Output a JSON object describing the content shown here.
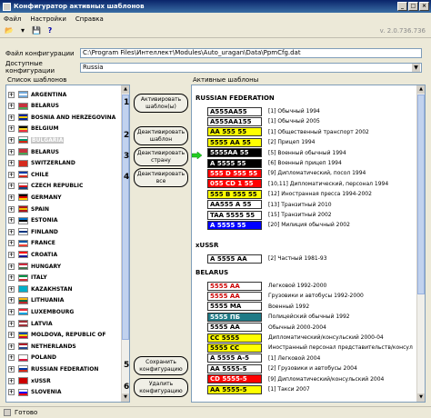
{
  "window": {
    "title": "Конфигуратор активных шаблонов",
    "controls": [
      "_",
      "□",
      "×"
    ]
  },
  "menu": [
    "Файл",
    "Настройки",
    "Справка"
  ],
  "version": "v. 2.0.736.736",
  "config_file": {
    "label": "Файл конфигурации",
    "value": "C:\\Program Files\\Интеллект\\Modules\\Auto_uragan\\Data\\PpmCfg.dat"
  },
  "available_configs": {
    "label": "Доступные конфигурации",
    "value": "Russia"
  },
  "template_list_label": "Список шаблонов",
  "active_templates_label": "Активные шаблоны",
  "countries": [
    {
      "name": "ARGENTINA",
      "colors": [
        "#75aadb",
        "#ffffff",
        "#75aadb"
      ]
    },
    {
      "name": "BELARUS",
      "colors": [
        "#c8313e",
        "#c8313e",
        "#4aa657"
      ]
    },
    {
      "name": "BOSNIA AND HERZEGOVINA",
      "colors": [
        "#002395",
        "#fecb00",
        "#002395"
      ]
    },
    {
      "name": "BELGIUM",
      "colors": [
        "#000000",
        "#fdda24",
        "#ef3340"
      ]
    },
    {
      "name": "BULGARIA",
      "colors": [
        "#ffffff",
        "#00966e",
        "#d62612"
      ]
    },
    {
      "name": "BELARUS",
      "colors": [
        "#c8313e",
        "#c8313e",
        "#4aa657"
      ]
    },
    {
      "name": "SWITZERLAND",
      "colors": [
        "#d52b1e",
        "#d52b1e",
        "#d52b1e"
      ]
    },
    {
      "name": "CHILE",
      "colors": [
        "#0039a6",
        "#ffffff",
        "#d52b1e"
      ]
    },
    {
      "name": "CZECH REPUBLIC",
      "colors": [
        "#ffffff",
        "#d7141a",
        "#11457e"
      ]
    },
    {
      "name": "GERMANY",
      "colors": [
        "#000000",
        "#dd0000",
        "#ffce00"
      ]
    },
    {
      "name": "SPAIN",
      "colors": [
        "#aa151b",
        "#f1bf00",
        "#aa151b"
      ]
    },
    {
      "name": "ESTONIA",
      "colors": [
        "#0072ce",
        "#000000",
        "#ffffff"
      ]
    },
    {
      "name": "FINLAND",
      "colors": [
        "#ffffff",
        "#003580",
        "#ffffff"
      ]
    },
    {
      "name": "FRANCE",
      "colors": [
        "#0055a4",
        "#ffffff",
        "#ef4135"
      ]
    },
    {
      "name": "CROATIA",
      "colors": [
        "#ff0000",
        "#ffffff",
        "#171796"
      ]
    },
    {
      "name": "HUNGARY",
      "colors": [
        "#cd2a3e",
        "#ffffff",
        "#436f4d"
      ]
    },
    {
      "name": "ITALY",
      "colors": [
        "#009246",
        "#ffffff",
        "#ce2b37"
      ]
    },
    {
      "name": "KAZAKHSTAN",
      "colors": [
        "#00afca",
        "#00afca",
        "#00afca"
      ]
    },
    {
      "name": "LITHUANIA",
      "colors": [
        "#fdb913",
        "#006a44",
        "#c1272d"
      ]
    },
    {
      "name": "LUXEMBOURG",
      "colors": [
        "#ed2939",
        "#ffffff",
        "#00a1de"
      ]
    },
    {
      "name": "LATVIA",
      "colors": [
        "#9e3039",
        "#ffffff",
        "#9e3039"
      ]
    },
    {
      "name": "MOLDOVA, REPUBLIC OF",
      "colors": [
        "#0046ae",
        "#ffd200",
        "#cc092f"
      ]
    },
    {
      "name": "NETHERLANDS",
      "colors": [
        "#ae1c28",
        "#ffffff",
        "#21468b"
      ]
    },
    {
      "name": "POLAND",
      "colors": [
        "#ffffff",
        "#ffffff",
        "#dc143c"
      ]
    },
    {
      "name": "RUSSIAN FEDERATION",
      "colors": [
        "#ffffff",
        "#0039a6",
        "#d52b1e"
      ]
    },
    {
      "name": "xUSSR",
      "colors": [
        "#cc0000",
        "#cc0000",
        "#cc0000"
      ]
    },
    {
      "name": "SLOVENIA",
      "colors": [
        "#ffffff",
        "#0000ff",
        "#ff0000"
      ]
    }
  ],
  "buttons": [
    {
      "num": "1",
      "label": "Активировать шаблон(ы)"
    },
    {
      "num": "2",
      "label": "Деактивировать шаблон"
    },
    {
      "num": "3",
      "label": "Деактивировать страну"
    },
    {
      "num": "4",
      "label": "Деактивировать все"
    },
    {
      "num": "5",
      "label": "Сохранить конфигурацию"
    },
    {
      "num": "6",
      "label": "Удалить конфигурацию"
    }
  ],
  "active_sections": [
    {
      "title": "RUSSIAN FEDERATION",
      "rows": [
        {
          "plate": "A555AA55",
          "bg": "#ffffff",
          "fg": "#000000",
          "text": "[1] Обычный 1994"
        },
        {
          "plate": "A555AA155",
          "bg": "#ffffff",
          "fg": "#000000",
          "text": "[1] Обычный 2005"
        },
        {
          "plate": "AA 555 55",
          "bg": "#ffff00",
          "fg": "#000000",
          "text": "[1] Общественный транспорт 2002"
        },
        {
          "plate": "5555 AA 55",
          "bg": "#ffff00",
          "fg": "#000000",
          "text": "[2] Прицеп 1994"
        },
        {
          "plate": "5555AA 55",
          "bg": "#000000",
          "fg": "#ffffff",
          "text": "[5] Военный обычный 1994"
        },
        {
          "plate": "A 5555 55",
          "bg": "#000000",
          "fg": "#ffffff",
          "text": "[6] Военный прицеп 1994"
        },
        {
          "plate": "555 D 555 55",
          "bg": "#ff0000",
          "fg": "#ffffff",
          "text": "[9] Дипломатический, посол 1994"
        },
        {
          "plate": "055 CD 1 55",
          "bg": "#ff0000",
          "fg": "#ffffff",
          "text": "[10,11] Дипломатический, персонал 1994"
        },
        {
          "plate": "555 B 555 55",
          "bg": "#ffff00",
          "fg": "#000000",
          "text": "[12] Иностранная пресса 1994-2002"
        },
        {
          "plate": "AA555 A 55",
          "bg": "#ffffff",
          "fg": "#000000",
          "text": "[13] Транзитный 2010"
        },
        {
          "plate": "TAA 5555 55",
          "bg": "#ffffff",
          "fg": "#000000",
          "text": "[15] Транзитный 2002"
        },
        {
          "plate": "A 5555 55",
          "bg": "#0000ff",
          "fg": "#ffffff",
          "text": "[20] Милиция обычный 2002"
        }
      ]
    },
    {
      "title": "xUSSR",
      "rows": [
        {
          "plate": "A 5555 AA",
          "bg": "#ffffff",
          "fg": "#000000",
          "text": "[2] Частный 1981-93"
        }
      ]
    },
    {
      "title": "BELARUS",
      "rows": [
        {
          "plate": "5555 AA",
          "bg": "#ffffff",
          "fg": "#cc0000",
          "text": "Легковой 1992-2000"
        },
        {
          "plate": "5555 AA",
          "bg": "#ffffff",
          "fg": "#cc0000",
          "text": "Грузовики и автобусы 1992-2000"
        },
        {
          "plate": "5555 MA",
          "bg": "#ffffff",
          "fg": "#000000",
          "text": "Военный 1992"
        },
        {
          "plate": "5555 ПБ",
          "bg": "#1f7a86",
          "fg": "#ffffff",
          "text": "Полицейский обычный 1992"
        },
        {
          "plate": "5555 AA",
          "bg": "#ffffff",
          "fg": "#000000",
          "text": "Обычный 2000-2004"
        },
        {
          "plate": "CC 5555",
          "bg": "#ffff00",
          "fg": "#000000",
          "text": "Дипломатический/консульский 2000-04"
        },
        {
          "plate": "5555 CC",
          "bg": "#ffff00",
          "fg": "#000000",
          "text": "Иностранный персонал представительств/консул"
        },
        {
          "plate": "A 5555 A-5",
          "bg": "#ffffff",
          "fg": "#000000",
          "text": "[1] Легковой 2004"
        },
        {
          "plate": "AA 5555-5",
          "bg": "#ffffff",
          "fg": "#000000",
          "text": "[2] Грузовики и автобусы 2004"
        },
        {
          "plate": "CD 5555-5",
          "bg": "#ff0000",
          "fg": "#ffffff",
          "text": "[9] Дипломатический/консульский 2004"
        },
        {
          "plate": "AA 5555-5",
          "bg": "#ffff00",
          "fg": "#000000",
          "text": "[1] Такси 2007"
        }
      ]
    }
  ],
  "status": "Готово"
}
